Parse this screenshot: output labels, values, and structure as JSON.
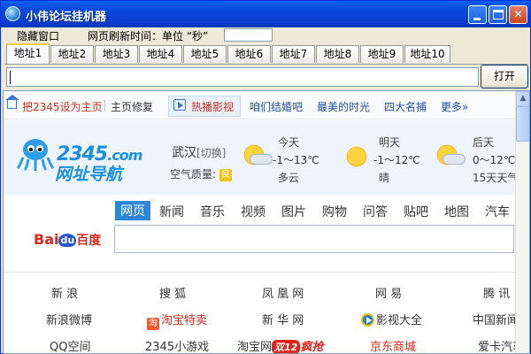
{
  "window": {
    "title": "小伟论坛挂机器",
    "min_label": "",
    "max_label": "",
    "close_label": "✕"
  },
  "menubar": {
    "hide_label": "隐藏窗口",
    "refresh_label": "网页刷新时间：单位 “秒”",
    "refresh_value": ""
  },
  "tabs": [
    "地址1",
    "地址2",
    "地址3",
    "地址4",
    "地址5",
    "地址6",
    "地址7",
    "地址8",
    "地址9",
    "地址10"
  ],
  "active_tab": "地址1",
  "url": {
    "value": "",
    "open_label": "打开"
  },
  "page": {
    "topbar": {
      "set_home": "把2345设为主页",
      "repair": "主页修复",
      "hot_label": "热播影视",
      "links": [
        "咱们结婚吧",
        "最美的时光",
        "四大名捕",
        "更多"
      ],
      "more_icon": "»"
    },
    "logo": {
      "brand": "2345",
      "com": ".com",
      "sub": "网址导航"
    },
    "weather": {
      "city": "武汉",
      "switch": "[切换]",
      "air_label": "空气质量:",
      "air_value": "良",
      "days": [
        {
          "label": "今天",
          "temp": "-1～13℃",
          "desc": "多云",
          "icon": "partly-cloudy-icon"
        },
        {
          "label": "明天",
          "temp": "-1～12℃",
          "desc": "晴",
          "icon": "sun-icon"
        },
        {
          "label": "后天",
          "temp": "0～12℃",
          "desc": "15天天气",
          "icon": "partly-cloudy-icon"
        }
      ]
    },
    "search": {
      "tabs": [
        "网页",
        "新闻",
        "音乐",
        "视频",
        "图片",
        "购物",
        "问答",
        "贴吧",
        "地图",
        "汽车"
      ],
      "active": "网页",
      "engine": "Bai",
      "engine_du": "du",
      "engine_cn": "百度",
      "value": ""
    },
    "links_row1": [
      "新  浪",
      "搜  狐",
      "凤 凰 网",
      "网  易",
      "腾  讯"
    ],
    "links_row2": [
      "新浪微博",
      "淘宝特卖",
      "新 华 网",
      "影视大全",
      "中国新闻"
    ],
    "links_row3": [
      "QQ空间",
      "2345小游戏",
      "淘宝网",
      "京东商城",
      "爱卡汽车"
    ],
    "double12": "双12",
    "crazy": "疯抢",
    "tao_icon": "淘"
  }
}
